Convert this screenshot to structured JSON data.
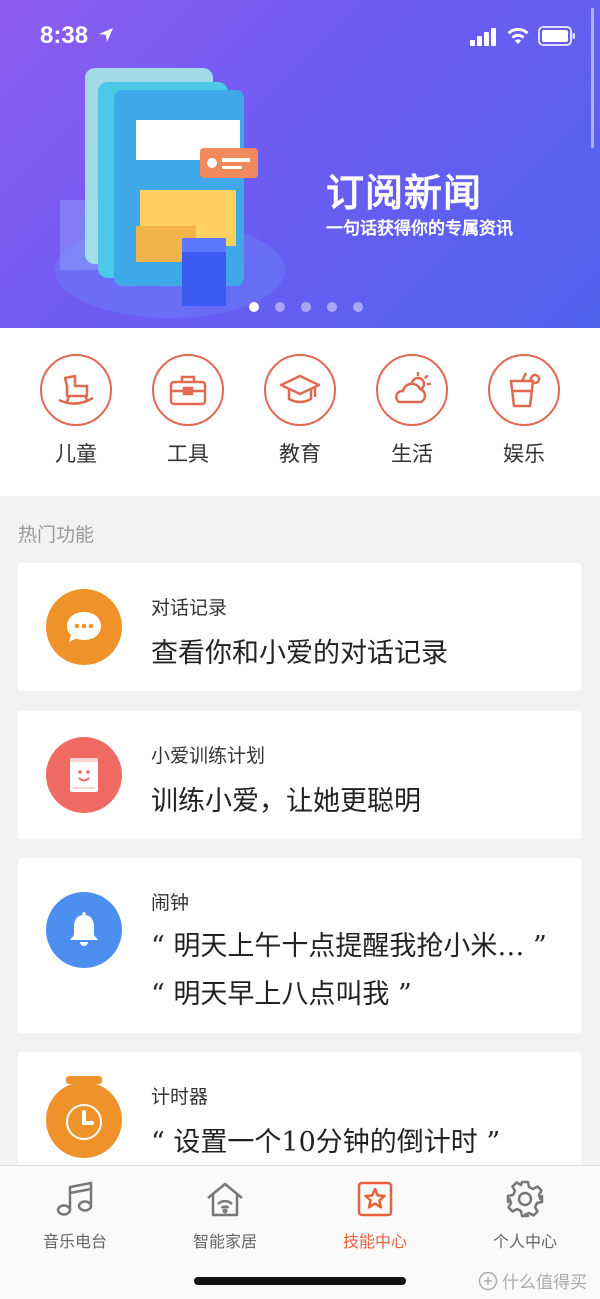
{
  "status_bar": {
    "time": "8:38"
  },
  "banner": {
    "title": "订阅新闻",
    "subtitle": "一句话获得你的专属资讯",
    "page_count": 5,
    "active_page": 1
  },
  "categories": [
    {
      "label": "儿童",
      "icon": "rocking-horse-icon"
    },
    {
      "label": "工具",
      "icon": "toolbox-icon"
    },
    {
      "label": "教育",
      "icon": "graduation-cap-icon"
    },
    {
      "label": "生活",
      "icon": "weather-icon"
    },
    {
      "label": "娱乐",
      "icon": "drink-cup-icon"
    }
  ],
  "section_title": "热门功能",
  "cards": [
    {
      "title": "对话记录",
      "lines": [
        "查看你和小爱的对话记录"
      ],
      "icon": "chat-bubble-icon",
      "color": "#f0922a"
    },
    {
      "title": "小爱训练计划",
      "lines": [
        "训练小爱，让她更聪明"
      ],
      "icon": "smile-book-icon",
      "color": "#ef6a62"
    },
    {
      "title": "闹钟",
      "lines": [
        "“ 明天上午十点提醒我抢小米… ”",
        "“ 明天早上八点叫我 ”"
      ],
      "icon": "bell-icon",
      "color": "#4d8ff0"
    },
    {
      "title": "计时器",
      "lines": [
        "“ 设置一个10分钟的倒计时 ”"
      ],
      "icon": "stopwatch-icon",
      "color": "#f0922a"
    }
  ],
  "tabs": [
    {
      "label": "音乐电台",
      "icon": "music-note-icon",
      "active": false
    },
    {
      "label": "智能家居",
      "icon": "smart-home-icon",
      "active": false
    },
    {
      "label": "技能中心",
      "icon": "star-box-icon",
      "active": true
    },
    {
      "label": "个人中心",
      "icon": "gear-icon",
      "active": false
    }
  ],
  "colors": {
    "accent": "#e8603c",
    "category_outline": "#e06a50",
    "banner_start": "#8f5cf0",
    "banner_end": "#4f63ef"
  },
  "watermark": "什么值得买"
}
